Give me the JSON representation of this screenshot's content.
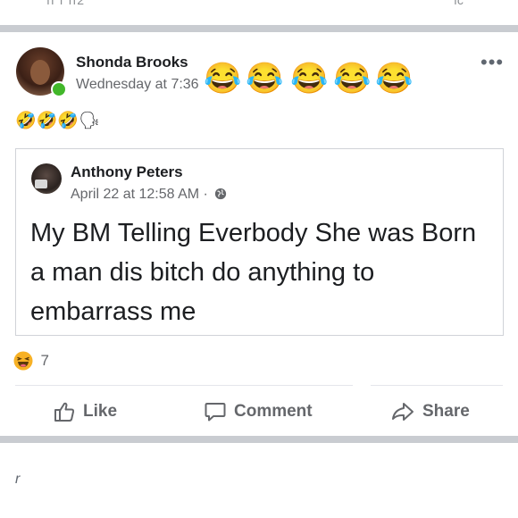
{
  "top_fragment": {
    "left": "ıı ı ıı2",
    "right": "ıc"
  },
  "post": {
    "author": "Shonda Brooks",
    "timestamp": "Wednesday at 7:36",
    "header_emojis": [
      "😂",
      "😂",
      "😂",
      "😂",
      "😂"
    ],
    "caption": "🤣🤣🤣🗣",
    "shared": {
      "author": "Anthony Peters",
      "timestamp": "April 22 at 12:58 AM ·",
      "text": "My BM Telling Everbody She was Born a man dis bitch do anything to embarrass me"
    },
    "reactions": {
      "icon": "haha-reaction-icon",
      "count": "7"
    },
    "actions": {
      "like": "Like",
      "comment": "Comment",
      "share": "Share"
    }
  },
  "bottom_mark": "r",
  "colors": {
    "online": "#42b72a",
    "secondary_text": "#65676b",
    "divider": "#c9ccd1",
    "haha_yellow": "#f7b125"
  }
}
